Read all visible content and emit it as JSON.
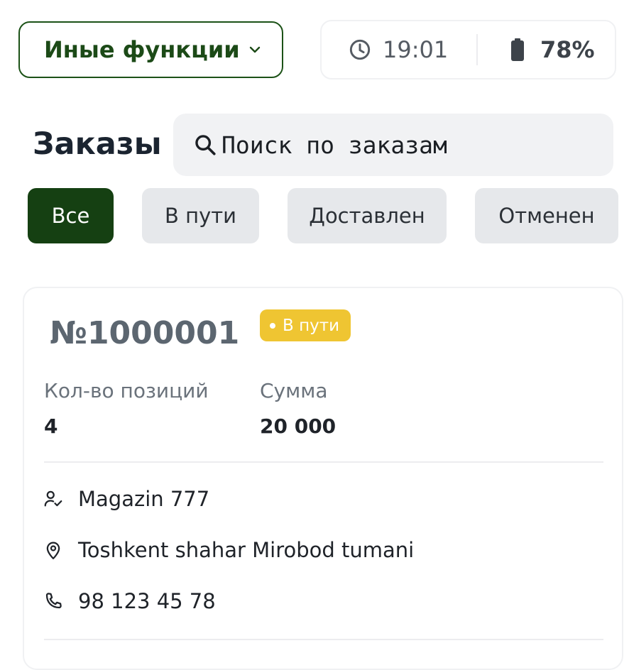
{
  "header": {
    "functions_label": "Иные функции",
    "time": "19:01",
    "battery": "78%"
  },
  "page": {
    "title": "Заказы"
  },
  "search": {
    "placeholder": "Поиск по заказам"
  },
  "filters": [
    {
      "label": "Все",
      "active": true
    },
    {
      "label": "В пути",
      "active": false
    },
    {
      "label": "Доставлен",
      "active": false
    },
    {
      "label": "Отменен",
      "active": false
    }
  ],
  "order": {
    "number": "№1000001",
    "status": "В пути",
    "positions_label": "Кол-во позиций",
    "positions_value": "4",
    "sum_label": "Сумма",
    "sum_value": "20 000",
    "shop": "Magazin 777",
    "address": "Toshkent shahar Mirobod tumani",
    "phone": "98 123 45 78"
  },
  "icons": {
    "dropdown": "chevron-down-icon",
    "time": "clock-icon",
    "battery": "battery-icon",
    "search": "search-icon",
    "shop": "user-check-icon",
    "address": "location-pin-icon",
    "phone": "phone-icon"
  },
  "colors": {
    "brand_green": "#154012",
    "status_yellow": "#efc532",
    "tab_inactive": "#e6e8eb"
  }
}
